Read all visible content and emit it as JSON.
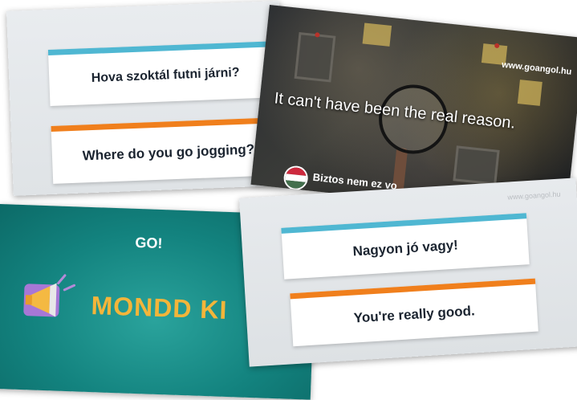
{
  "card1": {
    "question": "Hova szoktál futni járni?",
    "answer": "Where do you go jogging?"
  },
  "card2": {
    "watermark": "www.goangol.hu",
    "sentence": "It can't have been the real reason.",
    "subtitle": "Biztos nem ez vo",
    "flag_colors": [
      "#cd2a3e",
      "#ffffff",
      "#436f4d"
    ]
  },
  "card3": {
    "logo": "GO!",
    "title": "MONDD KI",
    "megaphone_icon": "megaphone-icon"
  },
  "card4": {
    "watermark": "www.goangol.hu",
    "question": "Nagyon jó vagy!",
    "answer": "You're really good."
  },
  "colors": {
    "top_bar": "#4fb7d2",
    "bottom_bar": "#f07f1c",
    "teal": "#13837f",
    "title_yellow": "#f3b53a"
  }
}
